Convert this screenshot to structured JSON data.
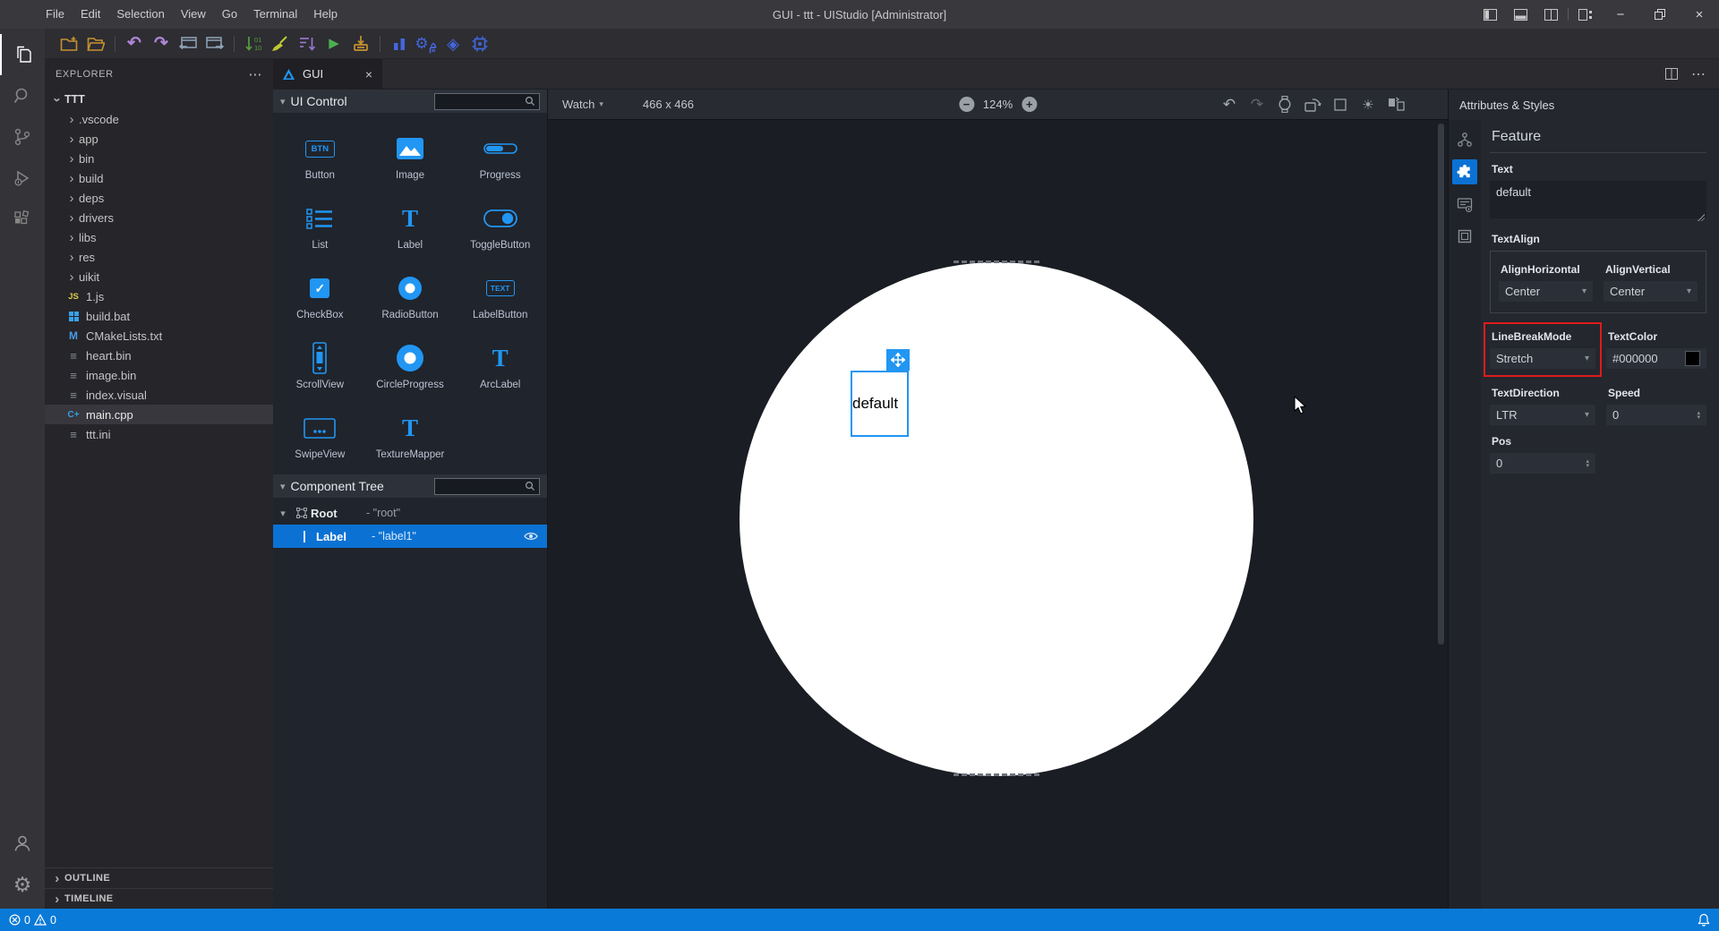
{
  "colors": {
    "accent": "#2196f3",
    "tree_selection": "#0b72d4",
    "status_bar": "#0a7ad8",
    "highlight_red": "#e01b1b"
  },
  "titlebar": {
    "title": "GUI - ttt - UIStudio [Administrator]",
    "menus": [
      "File",
      "Edit",
      "Selection",
      "View",
      "Go",
      "Terminal",
      "Help"
    ]
  },
  "explorer": {
    "header": "EXPLORER",
    "root": "TTT",
    "folders": [
      ".vscode",
      "app",
      "bin",
      "build",
      "deps",
      "drivers",
      "libs",
      "res",
      "uikit"
    ],
    "files": [
      {
        "name": "1.js",
        "icon": "js"
      },
      {
        "name": "build.bat",
        "icon": "windows"
      },
      {
        "name": "CMakeLists.txt",
        "icon": "cmake"
      },
      {
        "name": "heart.bin",
        "icon": "binary"
      },
      {
        "name": "image.bin",
        "icon": "binary"
      },
      {
        "name": "index.visual",
        "icon": "binary"
      },
      {
        "name": "main.cpp",
        "icon": "cpp",
        "selected": true
      },
      {
        "name": "ttt.ini",
        "icon": "binary"
      }
    ],
    "outline": "OUTLINE",
    "timeline": "TIMELINE"
  },
  "tab": {
    "label": "GUI"
  },
  "ui_control": {
    "title": "UI Control",
    "items": [
      {
        "label": "Button",
        "glyph": "BTN"
      },
      {
        "label": "Image"
      },
      {
        "label": "Progress"
      },
      {
        "label": "List"
      },
      {
        "label": "Label",
        "glyph": "T"
      },
      {
        "label": "ToggleButton"
      },
      {
        "label": "CheckBox",
        "glyph": "✓"
      },
      {
        "label": "RadioButton"
      },
      {
        "label": "LabelButton",
        "glyph": "TEXT"
      },
      {
        "label": "ScrollView"
      },
      {
        "label": "CircleProgress"
      },
      {
        "label": "ArcLabel",
        "glyph": "T"
      },
      {
        "label": "SwipeView"
      },
      {
        "label": "TextureMapper",
        "glyph": "T"
      }
    ]
  },
  "component_tree": {
    "title": "Component Tree",
    "root_type": "Root",
    "root_name": "- \"root\"",
    "label_type": "Label",
    "label_name": "- \"label1\""
  },
  "canvas": {
    "device_label": "Watch",
    "size_label": "466 x 466",
    "zoom_label": "124%",
    "label_text": "default"
  },
  "attributes": {
    "panel_title": "Attributes & Styles",
    "section": "Feature",
    "text_label": "Text",
    "text_value": "default",
    "textalign_label": "TextAlign",
    "align_h_label": "AlignHorizontal",
    "align_h_value": "Center",
    "align_v_label": "AlignVertical",
    "align_v_value": "Center",
    "linebreak_label": "LineBreakMode",
    "linebreak_value": "Stretch",
    "textcolor_label": "TextColor",
    "textcolor_value": "#000000",
    "textdirection_label": "TextDirection",
    "textdirection_value": "LTR",
    "speed_label": "Speed",
    "speed_value": "0",
    "pos_label": "Pos",
    "pos_value": "0"
  },
  "statusbar": {
    "errors": "0",
    "warnings": "0"
  }
}
